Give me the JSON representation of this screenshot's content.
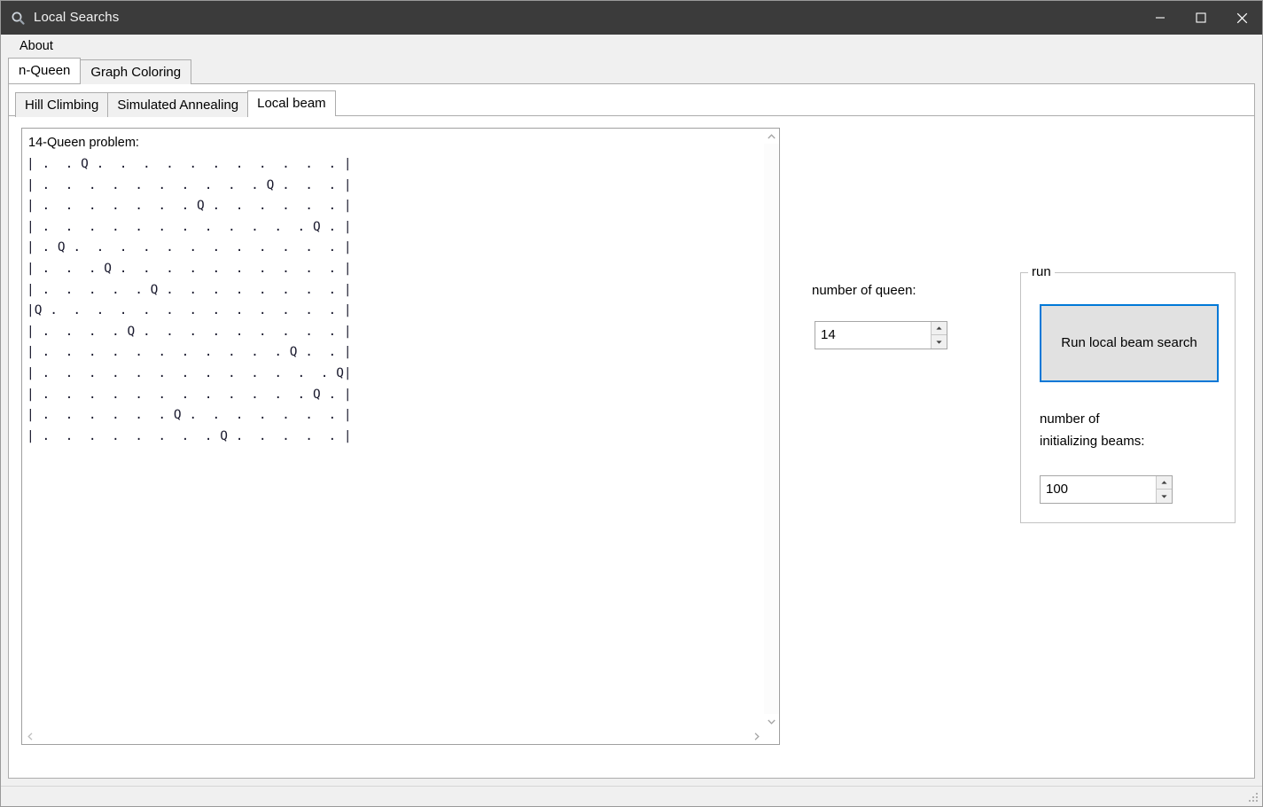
{
  "window": {
    "title": "Local Searchs",
    "icon": "magnifier-icon",
    "controls": {
      "minimize": "minimize-icon",
      "maximize": "maximize-icon",
      "close": "close-icon"
    }
  },
  "menubar": {
    "items": [
      "About"
    ]
  },
  "tabs_outer": [
    {
      "label": "n-Queen",
      "active": true
    },
    {
      "label": "Graph Coloring",
      "active": false
    }
  ],
  "tabs_inner": [
    {
      "label": "Hill Climbing",
      "active": false
    },
    {
      "label": "Simulated Annealing",
      "active": false
    },
    {
      "label": "Local beam",
      "active": true
    }
  ],
  "output": {
    "title": "14-Queen problem:",
    "board_rows": [
      "| .  . Q .  .  .  .  .  .  .  .  .  .  . |",
      "| .  .  .  .  .  .  .  .  .  . Q .  .  . |",
      "| .  .  .  .  .  .  . Q .  .  .  .  .  . |",
      "| .  .  .  .  .  .  .  .  .  .  .  . Q . |",
      "| . Q .  .  .  .  .  .  .  .  .  .  .  . |",
      "| .  .  . Q .  .  .  .  .  .  .  .  .  . |",
      "| .  .  .  .  . Q .  .  .  .  .  .  .  . |",
      "|Q .  .  .  .  .  .  .  .  .  .  .  .  . |",
      "| .  .  .  . Q .  .  .  .  .  .  .  .  . |",
      "| .  .  .  .  .  .  .  .  .  .  . Q .  . |",
      "| .  .  .  .  .  .  .  .  .  .  .  .  . Q|",
      "| .  .  .  .  .  .  .  .  .  .  .  . Q . |",
      "| .  .  .  .  .  . Q .  .  .  .  .  .  . |",
      "| .  .  .  .  .  .  .  . Q .  .  .  .  . |"
    ],
    "scrollbars": {
      "vertical_up": "chevron-up-icon",
      "vertical_down": "chevron-down-icon",
      "horizontal_left": "chevron-left-icon",
      "horizontal_right": "chevron-right-icon"
    }
  },
  "controls": {
    "queen_label": "number of queen:",
    "queen_value": "14",
    "group_title": "run",
    "run_button_label": "Run local beam search",
    "beams_label_line1": "number of",
    "beams_label_line2": "initializing beams:",
    "beams_value": "100"
  },
  "colors": {
    "titlebar": "#3b3b3b",
    "accent": "#0078d7",
    "panel": "#f0f0f0",
    "button_face": "#e1e1e1",
    "board_text": "#1a1a2e"
  },
  "statusbar": {
    "grip": "resize-grip-icon"
  }
}
